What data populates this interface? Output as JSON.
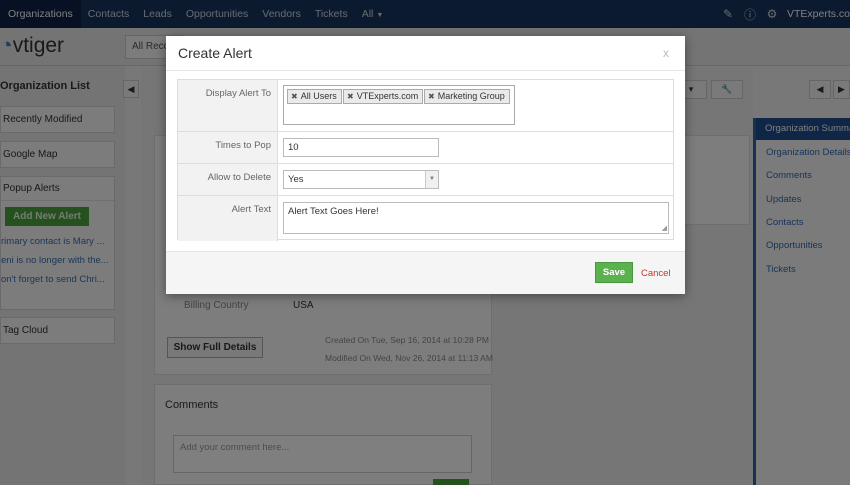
{
  "topnav": {
    "tabs": [
      "Organizations",
      "Contacts",
      "Leads",
      "Opportunities",
      "Vendors",
      "Tickets",
      "All"
    ],
    "user": "VTExperts.co",
    "icons": [
      "pencil-icon",
      "info-icon",
      "gear-icon"
    ]
  },
  "header": {
    "logo_text": "vtiger",
    "records_label": "All Reco"
  },
  "sidebar": {
    "title": "Organization List",
    "recently_modified": "Recently Modified",
    "google_map": "Google Map",
    "popup_alerts": "Popup Alerts",
    "add_new_alert": "Add New Alert",
    "alerts": [
      "rimary contact is Mary ...",
      "eni is no longer with the...",
      "on't forget to send Chri..."
    ],
    "tag_cloud": "Tag Cloud"
  },
  "detail": {
    "billing_country_label": "Billing Country",
    "billing_country_value": "USA",
    "show_full_details": "Show Full Details",
    "created_on": "Created On Tue, Sep 16, 2014 at 10:28 PM",
    "modified_on": "Modified On Wed, Nov 26, 2014 at 11:13 AM",
    "comments_title": "Comments",
    "comment_placeholder": "Add your comment here..."
  },
  "summary_panel": {
    "items": [
      "Organization Summa",
      "Organization Details",
      "Comments",
      "Updates",
      "Contacts",
      "Opportunities",
      "Tickets"
    ]
  },
  "modal": {
    "title": "Create Alert",
    "close": "x",
    "display_alert_to_label": "Display Alert To",
    "display_alert_to_tags": [
      "All Users",
      "VTExperts.com",
      "Marketing Group"
    ],
    "times_to_pop_label": "Times to Pop",
    "times_to_pop_value": "10",
    "allow_to_delete_label": "Allow to Delete",
    "allow_to_delete_value": "Yes",
    "alert_text_label": "Alert Text",
    "alert_text_value": "Alert Text Goes Here!",
    "save_label": "Save",
    "cancel_label": "Cancel"
  },
  "colors": {
    "nav_bg": "#18345f",
    "accent_blue": "#2b62a8",
    "save_green": "#5cb14f",
    "cancel_red": "#c0392b"
  }
}
